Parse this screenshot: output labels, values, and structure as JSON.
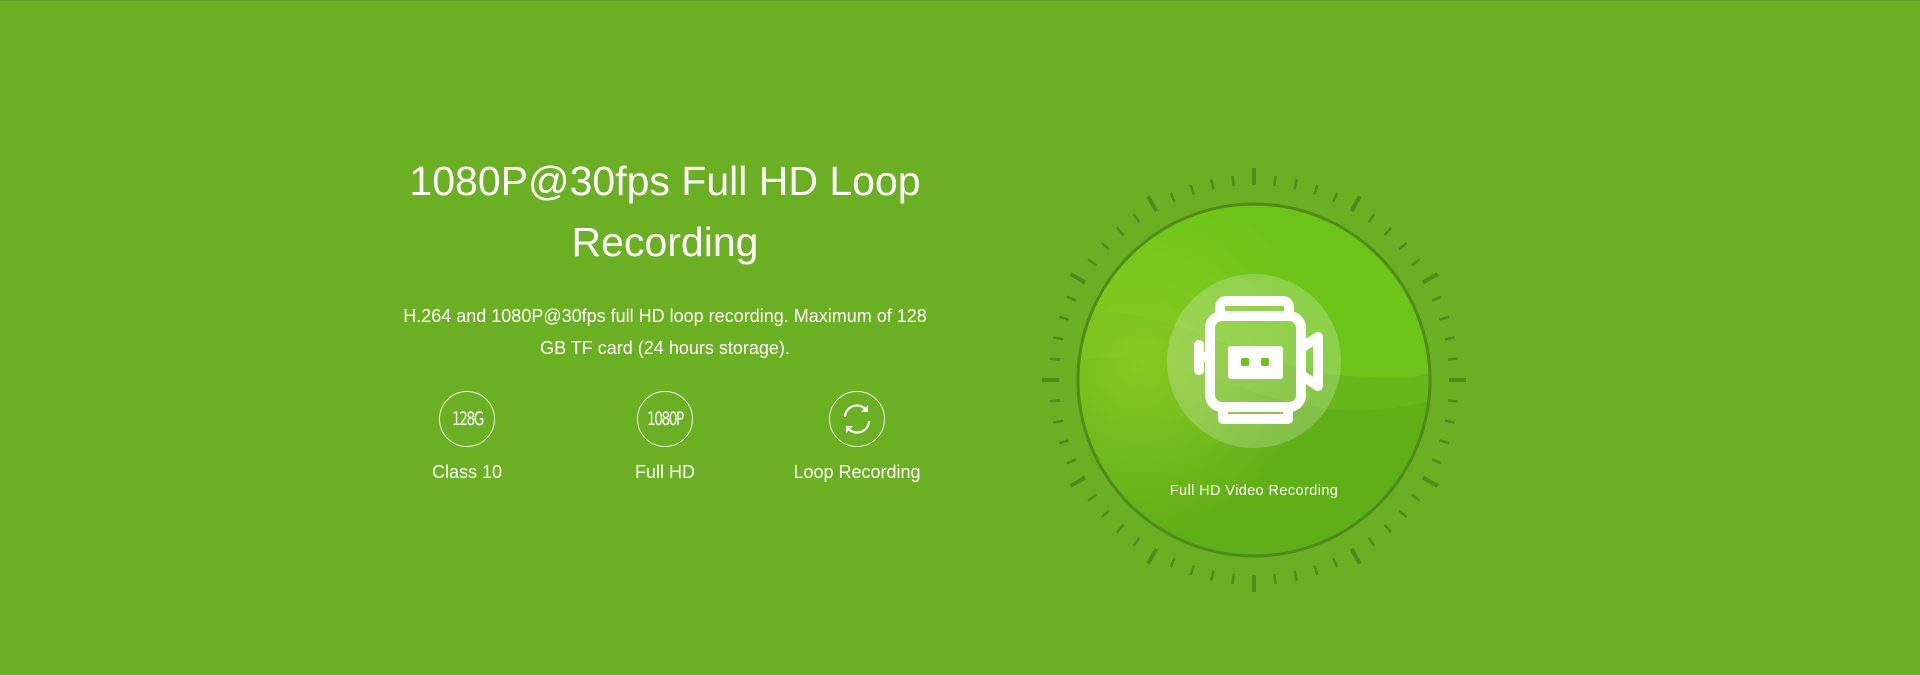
{
  "hero": {
    "title": "1080P@30fps Full HD Loop Recording",
    "description": "H.264 and 1080P@30fps full HD loop recording. Maximum of 128 GB TF card (24 hours storage)."
  },
  "features": [
    {
      "icon_text": "128G",
      "icon": "sd-card-capacity-icon",
      "label": "Class 10"
    },
    {
      "icon_text": "1080P",
      "icon": "resolution-icon",
      "label": "Full HD"
    },
    {
      "icon": "loop-arrows-icon",
      "label": "Loop Recording"
    }
  ],
  "dial": {
    "icon": "video-camera-icon",
    "caption": "Full HD Video Recording"
  },
  "colors": {
    "background": "#6baf22",
    "dial_inner": "#6cc317",
    "dial_ring": "#4e8c17",
    "ticks": "#4e8c17"
  }
}
